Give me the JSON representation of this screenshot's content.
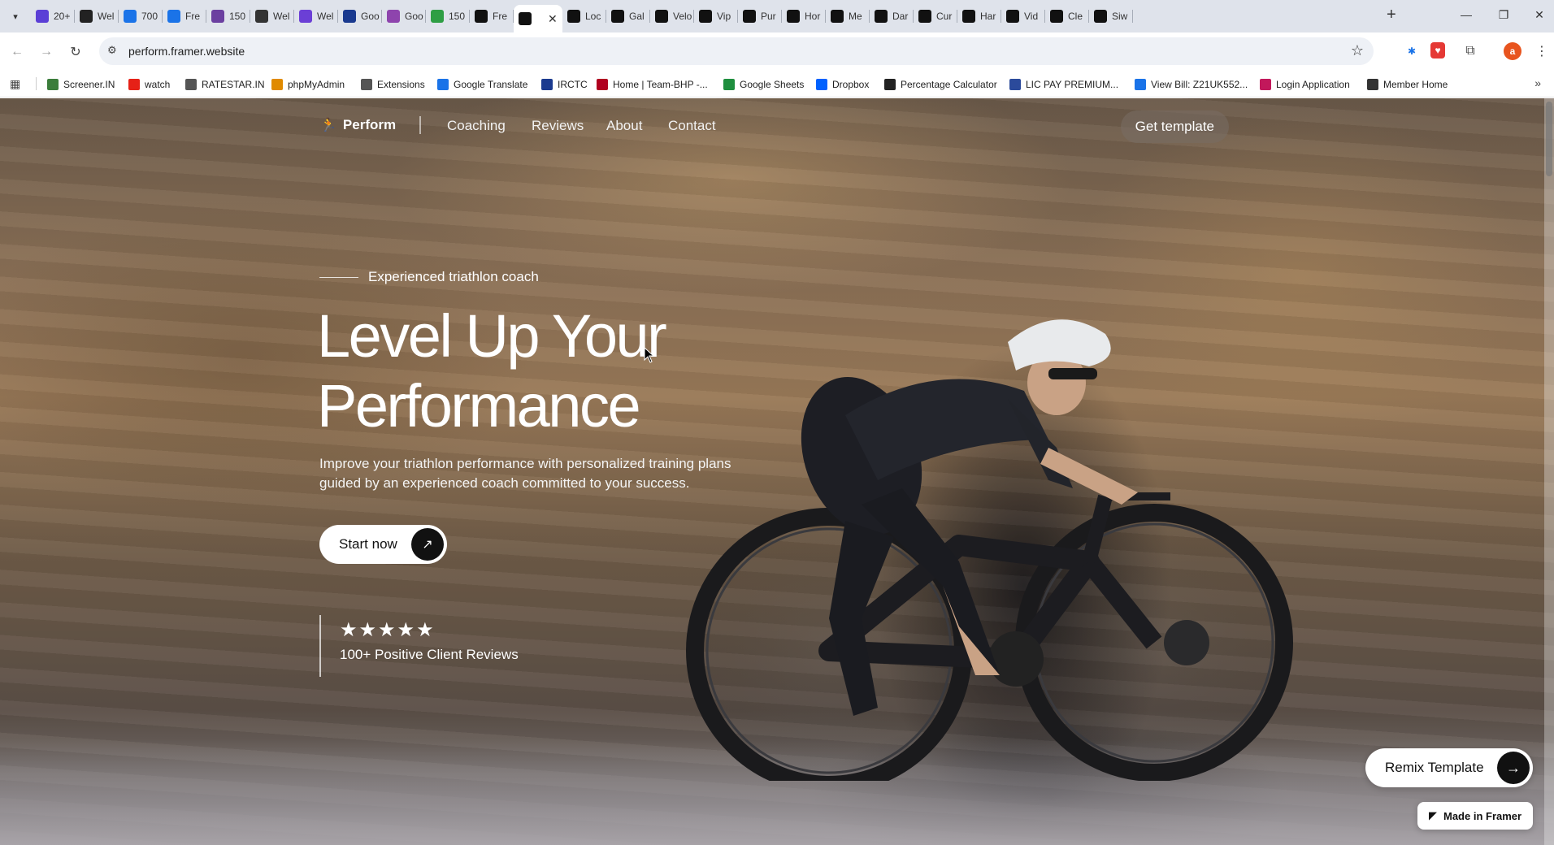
{
  "browser": {
    "tabs": [
      {
        "label": "20+",
        "icon": "a-letter-icon",
        "color": "#5b3fd6"
      },
      {
        "label": "Wel",
        "icon": "wix-icon",
        "color": "#222222"
      },
      {
        "label": "700",
        "icon": "square-icon",
        "color": "#1a73e8"
      },
      {
        "label": "Fre",
        "icon": "square-icon",
        "color": "#1a73e8"
      },
      {
        "label": "150",
        "icon": "square-icon",
        "color": "#6b3fa0"
      },
      {
        "label": "Wel",
        "icon": "swirl-icon",
        "color": "#333333"
      },
      {
        "label": "Wel",
        "icon": "h-letter-icon",
        "color": "#6b3fd6"
      },
      {
        "label": "Goo",
        "icon": "layout-icon",
        "color": "#1a3a8f"
      },
      {
        "label": "Goo",
        "icon": "circle-icon",
        "color": "#8e44ad"
      },
      {
        "label": "150",
        "icon": "drop-icon",
        "color": "#2e9e44"
      },
      {
        "label": "Fre",
        "icon": "framer-icon",
        "color": "#111111"
      },
      {
        "label": "",
        "icon": "runner-icon",
        "color": "#111111"
      },
      {
        "label": "Loc",
        "icon": "framer-icon",
        "color": "#111111"
      },
      {
        "label": "Gal",
        "icon": "framer-icon",
        "color": "#111111"
      },
      {
        "label": "Velo",
        "icon": "framer-icon",
        "color": "#111111"
      },
      {
        "label": "Vip",
        "icon": "framer-icon",
        "color": "#111111"
      },
      {
        "label": "Pur",
        "icon": "framer-icon",
        "color": "#111111"
      },
      {
        "label": "Hor",
        "icon": "framer-icon",
        "color": "#111111"
      },
      {
        "label": "Me",
        "icon": "framer-icon",
        "color": "#111111"
      },
      {
        "label": "Dar",
        "icon": "framer-icon",
        "color": "#111111"
      },
      {
        "label": "Cur",
        "icon": "framer-icon",
        "color": "#111111"
      },
      {
        "label": "Har",
        "icon": "framer-icon",
        "color": "#111111"
      },
      {
        "label": "Vid",
        "icon": "framer-icon",
        "color": "#111111"
      },
      {
        "label": "Cle",
        "icon": "framer-icon",
        "color": "#111111"
      },
      {
        "label": "Siw",
        "icon": "framer-icon",
        "color": "#111111"
      }
    ],
    "active_tab_index": 11,
    "url": "perform.framer.website",
    "profile_initial": "a",
    "bookmarks": [
      {
        "label": "Screener.IN",
        "color": "#3b7d3b"
      },
      {
        "label": "watch",
        "color": "#e62117"
      },
      {
        "label": "RATESTAR.IN",
        "color": "#555555"
      },
      {
        "label": "phpMyAdmin",
        "color": "#e08a00"
      },
      {
        "label": "Extensions",
        "color": "#555555"
      },
      {
        "label": "Google Translate",
        "color": "#1a73e8"
      },
      {
        "label": "IRCTC",
        "color": "#1a3a8f"
      },
      {
        "label": "Home | Team-BHP -...",
        "color": "#b00020"
      },
      {
        "label": "Google Sheets",
        "color": "#1e8e3e"
      },
      {
        "label": "Dropbox",
        "color": "#0061fe"
      },
      {
        "label": "Percentage Calculator",
        "color": "#222222"
      },
      {
        "label": "LIC PAY PREMIUM...",
        "color": "#2b4a9b"
      },
      {
        "label": "View Bill: Z21UK552...",
        "color": "#1a73e8"
      },
      {
        "label": "Login Application",
        "color": "#c2185b"
      },
      {
        "label": "Member Home",
        "color": "#333333"
      }
    ]
  },
  "site": {
    "brand": "Perform",
    "nav": [
      "Coaching",
      "Reviews",
      "About",
      "Contact"
    ],
    "cta_top": "Get template",
    "eyebrow": "Experienced triathlon coach",
    "headline_line1": "Level Up Your",
    "headline_line2": "Performance",
    "subtext": "Improve your triathlon performance with personalized training plans guided by an experienced coach committed to your success.",
    "start_label": "Start now",
    "stars": "★★★★★",
    "reviews_text": "100+ Positive Client Reviews",
    "remix_label": "Remix Template",
    "made_in_framer": "Made in Framer"
  }
}
